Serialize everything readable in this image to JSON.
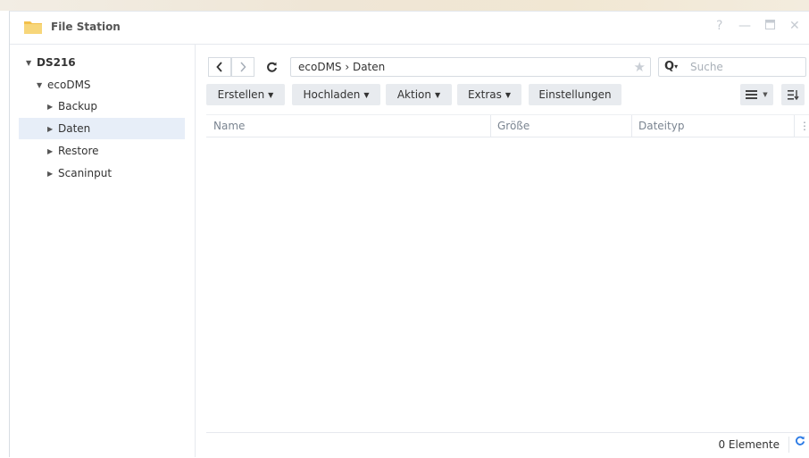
{
  "window": {
    "title": "File Station",
    "controls": {
      "help": "?",
      "minimize": "—",
      "maximize": "□",
      "close": "✕"
    }
  },
  "sidebar": {
    "root": "DS216",
    "share": "ecoDMS",
    "folders": [
      "Backup",
      "Daten",
      "Restore",
      "Scaninput"
    ],
    "selected": "Daten"
  },
  "navigation": {
    "back_icon": "chevron-left-icon",
    "forward_icon": "chevron-right-icon",
    "refresh_icon": "refresh-icon",
    "path": "ecoDMS › Daten"
  },
  "search": {
    "placeholder": "Suche"
  },
  "toolbar": {
    "create": "Erstellen",
    "upload": "Hochladen",
    "action": "Aktion",
    "extras": "Extras",
    "settings": "Einstellungen"
  },
  "table": {
    "columns": [
      "Name",
      "Größe",
      "Dateityp"
    ]
  },
  "status": {
    "count": "0 Elemente"
  },
  "colors": {
    "accent": "#2c7be5",
    "selected_bg": "#e7eef8",
    "button_bg": "#e8ebef"
  }
}
